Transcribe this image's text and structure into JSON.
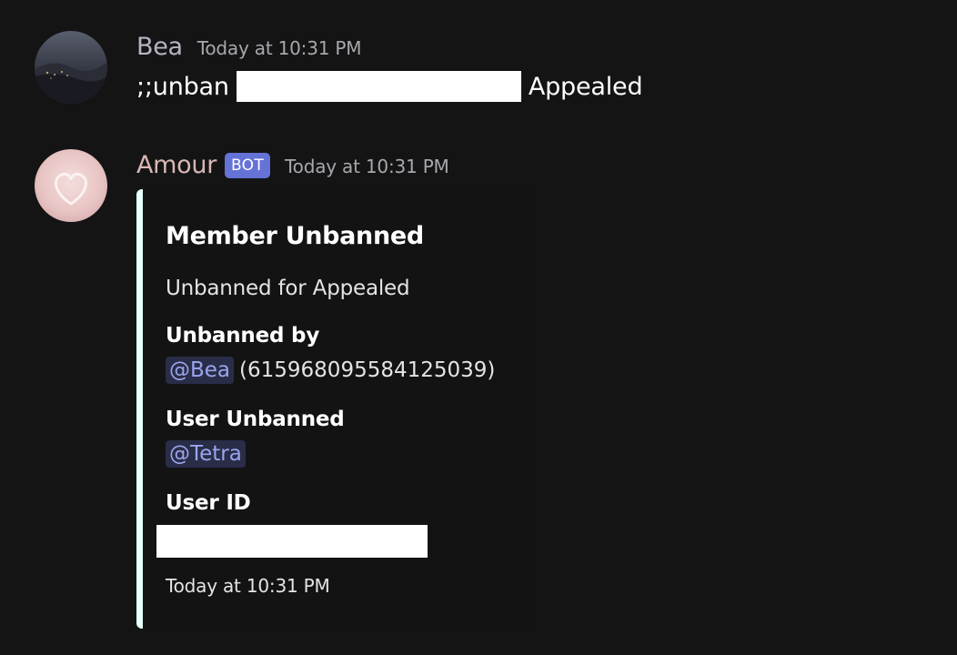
{
  "colors": {
    "background": "#141415",
    "embed_accent": "#e6fffa",
    "mention_bg": "#2a2d47",
    "mention_text": "#9aa5ee",
    "bot_badge": "#6572d6",
    "bea_name": "#b9b3c2",
    "amour_name": "#d9b7b4"
  },
  "messages": [
    {
      "author": "Bea",
      "timestamp": "Today at 10:31 PM",
      "avatar_icon": "landscape-avatar-icon",
      "text_prefix": ";;unban",
      "text_suffix": "Appealed"
    },
    {
      "author": "Amour",
      "badge": "BOT",
      "timestamp": "Today at 10:31 PM",
      "avatar_icon": "heart-avatar-icon",
      "embed": {
        "title": "Member Unbanned",
        "description": "Unbanned for Appealed",
        "fields": [
          {
            "name": "Unbanned by",
            "mention": "@Bea",
            "value": "(615968095584125039)"
          },
          {
            "name": "User Unbanned",
            "mention": "@Tetra"
          },
          {
            "name": "User ID"
          }
        ],
        "footer": "Today at 10:31 PM"
      }
    }
  ]
}
